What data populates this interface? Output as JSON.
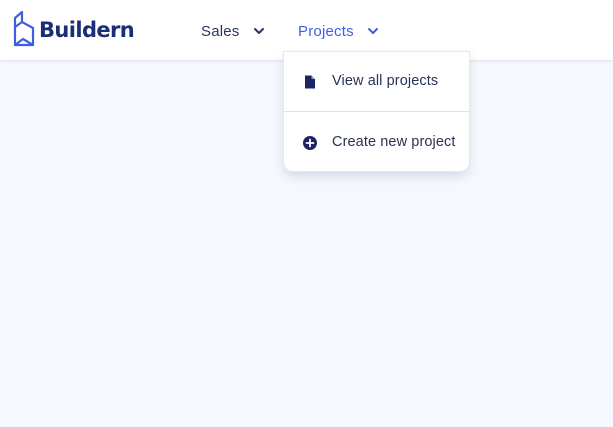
{
  "brand": {
    "name": "Buildern",
    "color": "#1c2d77",
    "logo_icon": "building-logo-icon"
  },
  "nav": {
    "items": [
      {
        "label": "Sales",
        "icon": "chevron-down-icon",
        "active": false,
        "color": "#2a3565"
      },
      {
        "label": "Projects",
        "icon": "chevron-down-icon",
        "active": true,
        "color": "#3f5fe0"
      }
    ]
  },
  "projects_menu": {
    "items": [
      {
        "label": "View all projects",
        "icon": "document-icon"
      },
      {
        "label": "Create new project",
        "icon": "plus-circle-icon"
      }
    ]
  },
  "colors": {
    "page_background": "#f5f8fe",
    "accent": "#3f5fe0",
    "icon_dark": "#1c2466"
  }
}
